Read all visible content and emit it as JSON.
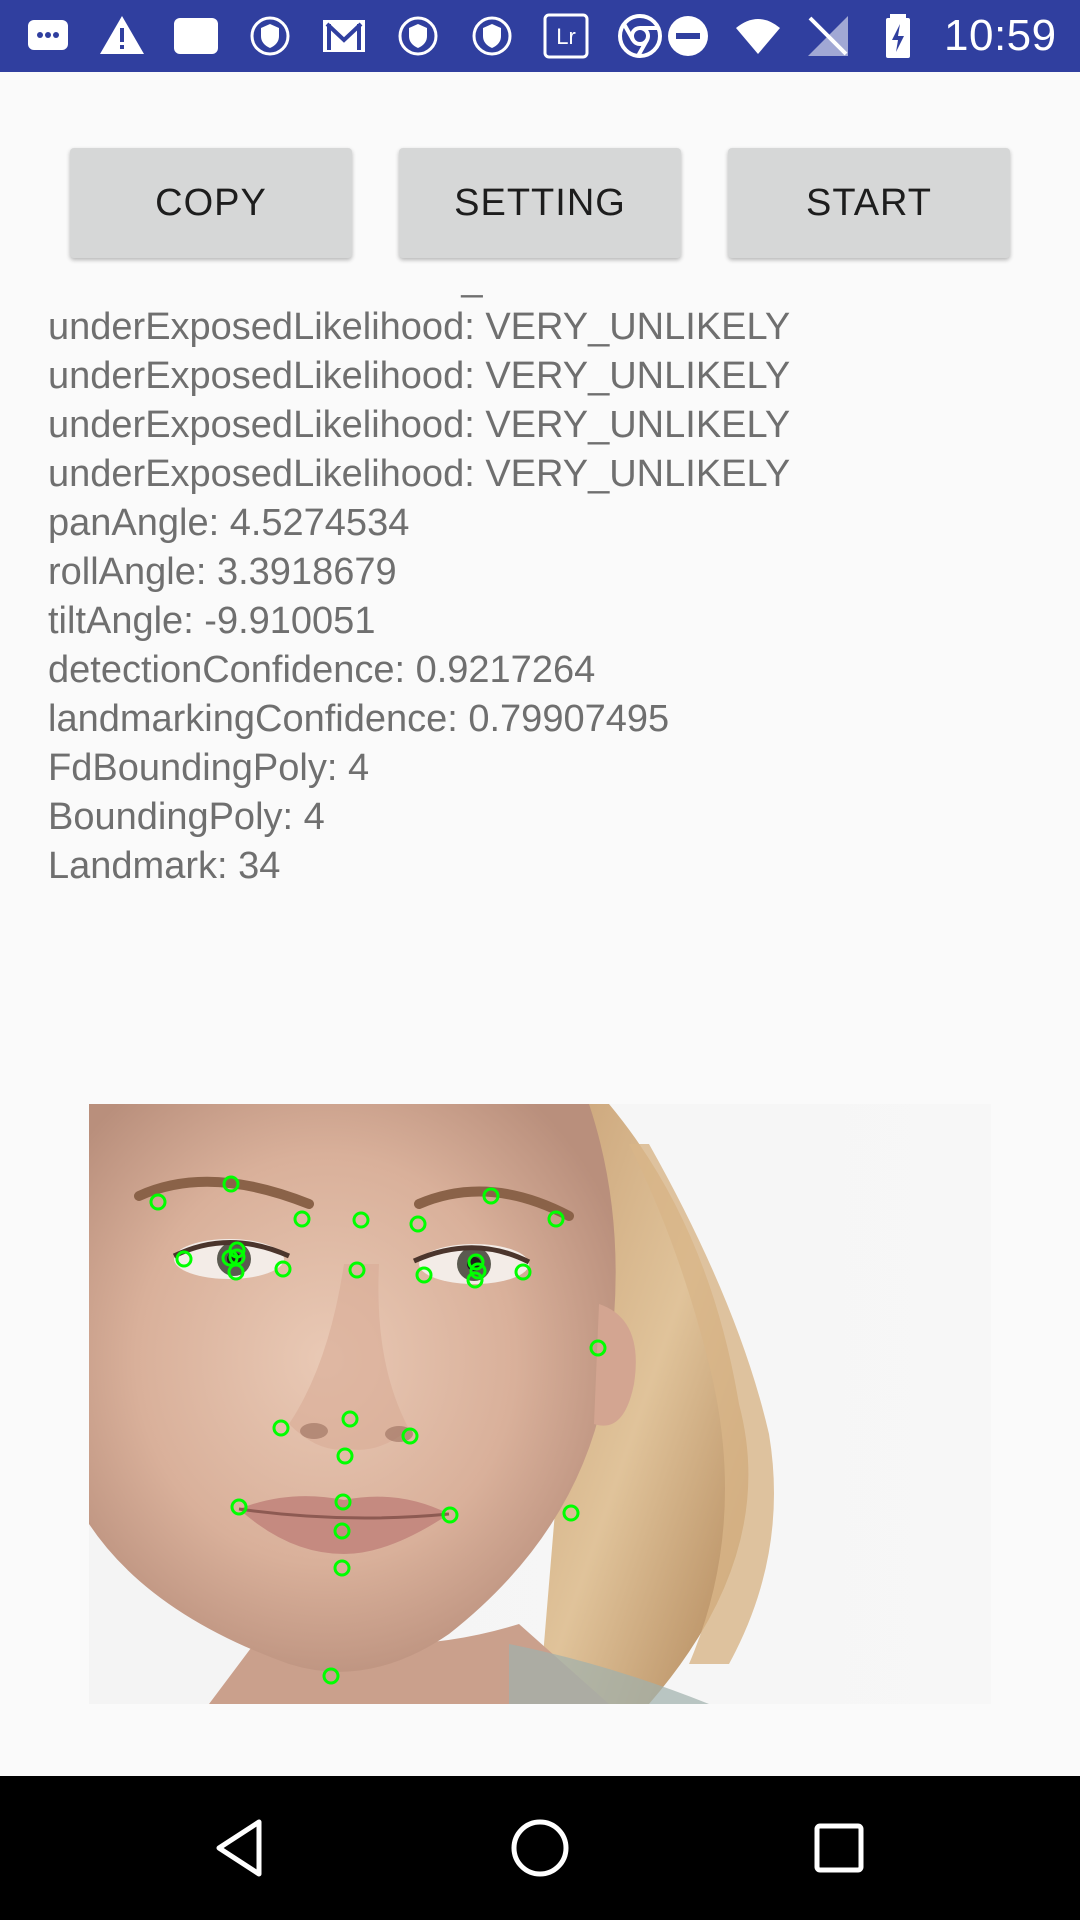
{
  "status_bar": {
    "time": "10:59",
    "background_color": "#303f9f",
    "left_icons": [
      "chat-icon",
      "warning-icon",
      "tablet-icon",
      "shield-icon",
      "gmail-icon",
      "shield-icon",
      "shield-icon",
      "lightroom-icon",
      "chrome-icon"
    ],
    "right_icons": [
      "do-not-disturb-icon",
      "wifi-icon",
      "no-signal-icon",
      "battery-charging-icon"
    ],
    "lightroom_label": "Lr"
  },
  "toolbar": {
    "copy_label": "COPY",
    "setting_label": "SETTING",
    "start_label": "START"
  },
  "results": {
    "partial_line": "blurredLikelihood: VERY_UNLIKELY",
    "lines": [
      "underExposedLikelihood: VERY_UNLIKELY",
      "underExposedLikelihood: VERY_UNLIKELY",
      "underExposedLikelihood: VERY_UNLIKELY",
      "underExposedLikelihood: VERY_UNLIKELY",
      "panAngle: 4.5274534",
      "rollAngle: 3.3918679",
      "tiltAngle: -9.910051",
      "detectionConfidence: 0.9217264",
      "landmarkingConfidence: 0.79907495",
      "FdBoundingPoly: 4",
      "BoundingPoly: 4",
      "Landmark: 34"
    ]
  },
  "face_image": {
    "description_icon": "face-photo",
    "landmark_color": "#00ff00"
  },
  "nav_bar": {
    "back_icon": "back-triangle-icon",
    "home_icon": "home-circle-icon",
    "recents_icon": "recents-square-icon"
  }
}
